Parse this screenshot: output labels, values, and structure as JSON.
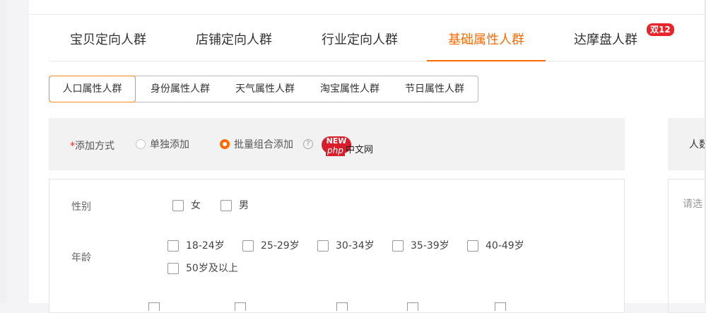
{
  "tabs": [
    {
      "label": "宝贝定向人群"
    },
    {
      "label": "店铺定向人群"
    },
    {
      "label": "行业定向人群"
    },
    {
      "label": "基础属性人群"
    },
    {
      "label": "达摩盘人群"
    }
  ],
  "tabs_badge": "双12",
  "active_tab_index": 3,
  "subtabs": [
    {
      "label": "人口属性人群"
    },
    {
      "label": "身份属性人群"
    },
    {
      "label": "天气属性人群"
    },
    {
      "label": "淘宝属性人群"
    },
    {
      "label": "节日属性人群"
    }
  ],
  "active_subtab_index": 0,
  "add_method": {
    "required_mark": "*",
    "label": "添加方式",
    "options": [
      {
        "label": "单独添加",
        "selected": false
      },
      {
        "label": "批量组合添加",
        "selected": true
      }
    ],
    "help_icon": "help-circle-icon",
    "new_badge": "NEW"
  },
  "watermark": {
    "prefix": "php",
    "suffix": "中文网"
  },
  "form": {
    "gender": {
      "label": "性别",
      "options": [
        "女",
        "男"
      ]
    },
    "age": {
      "label": "年龄",
      "options": [
        "18-24岁",
        "25-29岁",
        "30-34岁",
        "35-39岁",
        "40-49岁",
        "50岁及以上"
      ]
    }
  },
  "right_panel": {
    "title_partial": "人数",
    "placeholder_partial": "请选"
  },
  "colors": {
    "accent": "#ff6a00",
    "badge": "#e8252b",
    "bar_bg": "#f2f2f2"
  }
}
